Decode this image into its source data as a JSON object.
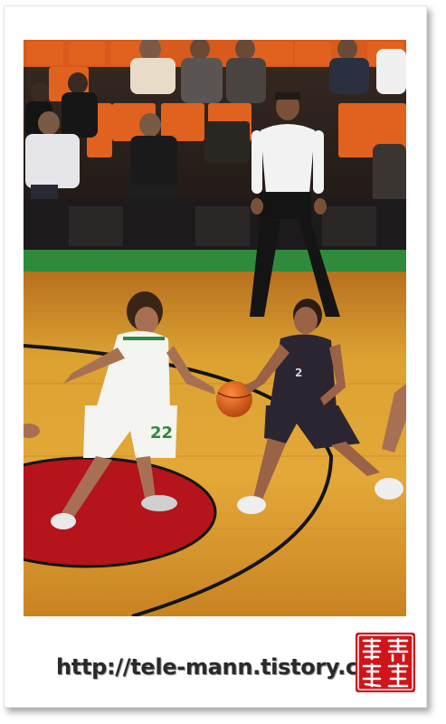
{
  "watermark": {
    "url_text": "http://tele-mann.tistory.com"
  },
  "photo": {
    "subject": "basketball-game",
    "jersey_number_white_player": "22",
    "jersey_number_dark_player": "2"
  },
  "colors": {
    "court_wood": "#d99a2a",
    "paint_red": "#b4141a",
    "seats_orange": "#e0621e",
    "sideline_green": "#2f8a3c",
    "white_jersey_trim": "#2e8b3e",
    "dark_jersey": "#2a2530",
    "seal_red": "#d0141a"
  }
}
